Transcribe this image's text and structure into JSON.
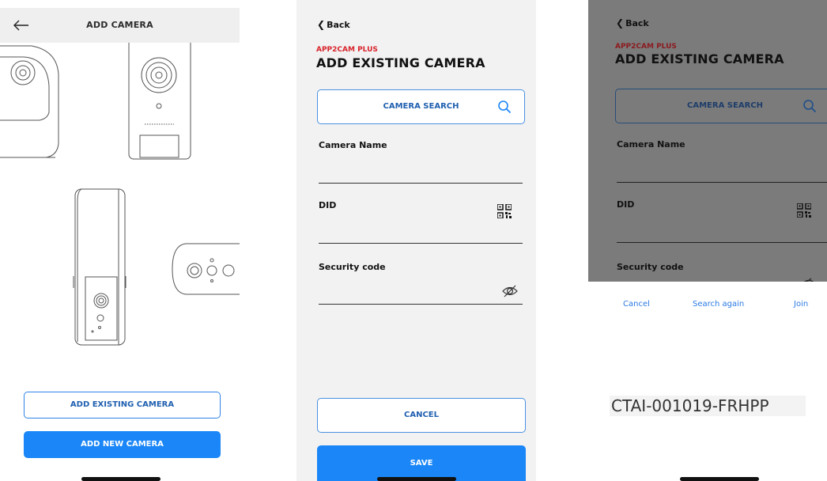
{
  "screen1": {
    "title": "ADD CAMERA",
    "icons": {
      "back": "arrow-left-icon"
    },
    "buttons": {
      "add_existing": "ADD EXISTING CAMERA",
      "add_new": "ADD NEW CAMERA"
    }
  },
  "screen2": {
    "back_label": "Back",
    "brand": "APP2CAM PLUS",
    "title": "ADD EXISTING CAMERA",
    "search_label": "CAMERA SEARCH",
    "fields": {
      "camera_name": "Camera Name",
      "did": "DID",
      "security_code": "Security code"
    },
    "buttons": {
      "cancel": "CANCEL",
      "save": "SAVE"
    },
    "colors": {
      "accent": "#1a86f7",
      "brand": "#d8232a"
    }
  },
  "screen3": {
    "back_label": "Back",
    "brand": "APP2CAM PLUS",
    "title": "ADD EXISTING CAMERA",
    "search_label": "CAMERA SEARCH",
    "fields": {
      "camera_name": "Camera Name",
      "did": "DID",
      "security_code": "Security code"
    },
    "actions": {
      "cancel": "Cancel",
      "search_again": "Search again",
      "join": "Join"
    },
    "found_did": "CTAI-001019-FRHPP"
  }
}
